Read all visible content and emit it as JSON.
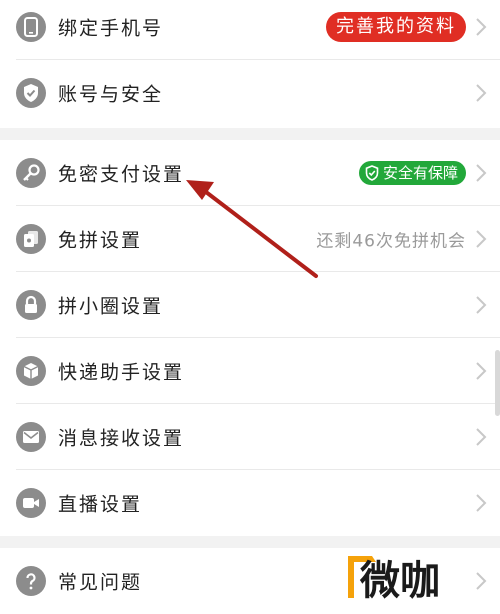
{
  "section1": {
    "rows": [
      {
        "label": "绑定手机号",
        "badge": "完善我的资料",
        "icon": "phone-icon"
      },
      {
        "label": "账号与安全",
        "icon": "shield-icon"
      }
    ]
  },
  "section2": {
    "rows": [
      {
        "label": "免密支付设置",
        "badge": "安全有保障",
        "icon": "key-icon"
      },
      {
        "label": "免拼设置",
        "right_text": "还剩46次免拼机会",
        "icon": "cards-icon"
      },
      {
        "label": "拼小圈设置",
        "icon": "lock-icon"
      },
      {
        "label": "快递助手设置",
        "icon": "package-icon"
      },
      {
        "label": "消息接收设置",
        "icon": "mail-icon"
      },
      {
        "label": "直播设置",
        "icon": "video-icon"
      }
    ]
  },
  "section3": {
    "rows": [
      {
        "label": "常见问题",
        "icon": "question-icon"
      }
    ]
  },
  "watermark": {
    "text": "微咖"
  },
  "colors": {
    "accent_red": "#e02e24",
    "accent_green": "#22a83a",
    "arrow": "#b0201a",
    "icon_gray": "#8c8c8c",
    "watermark_orange": "#f5a20a"
  }
}
